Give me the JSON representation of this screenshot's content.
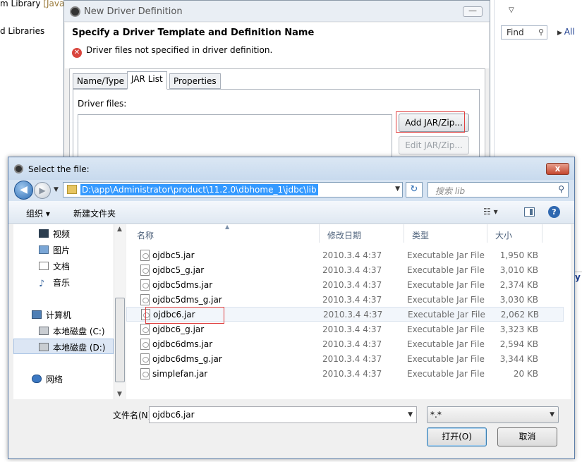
{
  "background": {
    "left_items": [
      {
        "text": "m Library",
        "annotation": "[JavaS"
      },
      {
        "text": "d Libraries",
        "annotation": ""
      }
    ],
    "find_placeholder": "Find",
    "all_label": "All",
    "right_edge_text": "y"
  },
  "driver_dialog": {
    "title": "New Driver Definition",
    "heading": "Specify a Driver Template and Definition Name",
    "error": "Driver files not specified in driver definition.",
    "min_label": "—",
    "tabs": [
      "Name/Type",
      "JAR List",
      "Properties"
    ],
    "active_tab": "JAR List",
    "driver_files_label": "Driver files:",
    "add_button": "Add JAR/Zip...",
    "edit_button": "Edit JAR/Zip..."
  },
  "select_dialog": {
    "title": "Select the file:",
    "close_label": "x",
    "address": "D:\\app\\Administrator\\product\\11.2.0\\dbhome_1\\jdbc\\lib",
    "search_placeholder": "搜索 lib",
    "toolbar": {
      "organize": "组织 ▾",
      "new_folder": "新建文件夹"
    },
    "nav_items": [
      {
        "label": "视频",
        "icon": "video-icon"
      },
      {
        "label": "图片",
        "icon": "picture-icon"
      },
      {
        "label": "文档",
        "icon": "document-icon"
      },
      {
        "label": "音乐",
        "icon": "music-icon"
      },
      {
        "label": "计算机",
        "icon": "computer-icon"
      },
      {
        "label": "本地磁盘 (C:)",
        "icon": "drive-icon"
      },
      {
        "label": "本地磁盘 (D:)",
        "icon": "drive-icon"
      },
      {
        "label": "网络",
        "icon": "network-icon"
      }
    ],
    "columns": {
      "name": "名称",
      "date": "修改日期",
      "type": "类型",
      "size": "大小"
    },
    "files": [
      {
        "name": "ojdbc5.jar",
        "date": "2010.3.4 4:37",
        "type": "Executable Jar File",
        "size": "1,950 KB"
      },
      {
        "name": "ojdbc5_g.jar",
        "date": "2010.3.4 4:37",
        "type": "Executable Jar File",
        "size": "3,010 KB"
      },
      {
        "name": "ojdbc5dms.jar",
        "date": "2010.3.4 4:37",
        "type": "Executable Jar File",
        "size": "2,374 KB"
      },
      {
        "name": "ojdbc5dms_g.jar",
        "date": "2010.3.4 4:37",
        "type": "Executable Jar File",
        "size": "3,030 KB"
      },
      {
        "name": "ojdbc6.jar",
        "date": "2010.3.4 4:37",
        "type": "Executable Jar File",
        "size": "2,062 KB"
      },
      {
        "name": "ojdbc6_g.jar",
        "date": "2010.3.4 4:37",
        "type": "Executable Jar File",
        "size": "3,323 KB"
      },
      {
        "name": "ojdbc6dms.jar",
        "date": "2010.3.4 4:37",
        "type": "Executable Jar File",
        "size": "2,594 KB"
      },
      {
        "name": "ojdbc6dms_g.jar",
        "date": "2010.3.4 4:37",
        "type": "Executable Jar File",
        "size": "3,344 KB"
      },
      {
        "name": "simplefan.jar",
        "date": "2010.3.4 4:37",
        "type": "Executable Jar File",
        "size": "20 KB"
      }
    ],
    "filename_label": "文件名(N):",
    "filename_value": "ojdbc6.jar",
    "filetype_value": "*.*",
    "open_button": "打开(O)",
    "cancel_button": "取消"
  }
}
